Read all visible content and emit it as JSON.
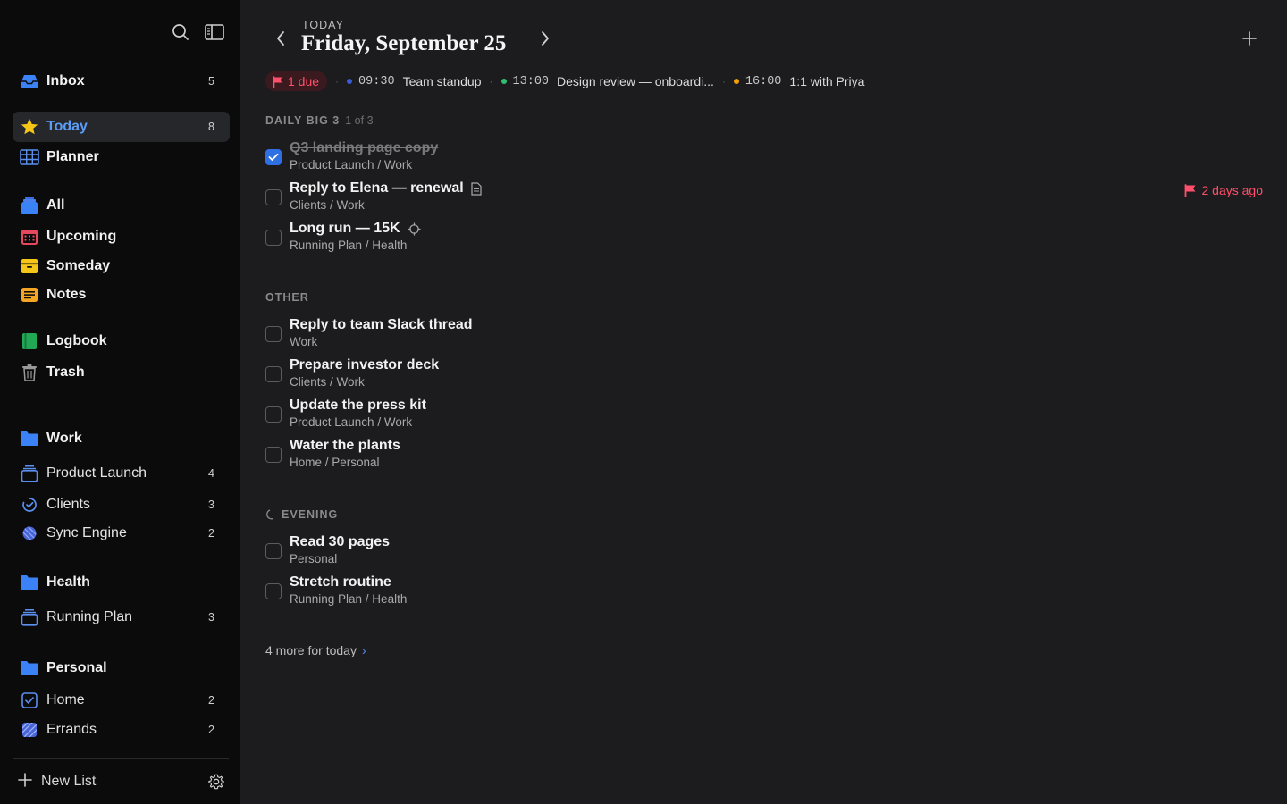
{
  "sidebar": {
    "items": {
      "inbox": {
        "label": "Inbox",
        "count": "5"
      },
      "today": {
        "label": "Today",
        "count": "8"
      },
      "planner": {
        "label": "Planner"
      },
      "all": {
        "label": "All"
      },
      "upcoming": {
        "label": "Upcoming"
      },
      "someday": {
        "label": "Someday"
      },
      "notes": {
        "label": "Notes"
      },
      "logbook": {
        "label": "Logbook"
      },
      "trash": {
        "label": "Trash"
      }
    },
    "areas": {
      "work": {
        "label": "Work"
      },
      "product_launch": {
        "label": "Product Launch",
        "count": "4"
      },
      "clients": {
        "label": "Clients",
        "count": "3"
      },
      "sync_engine": {
        "label": "Sync Engine",
        "count": "2"
      },
      "health": {
        "label": "Health"
      },
      "running_plan": {
        "label": "Running Plan",
        "count": "3"
      },
      "personal": {
        "label": "Personal"
      },
      "home": {
        "label": "Home",
        "count": "2"
      },
      "errands": {
        "label": "Errands",
        "count": "2"
      }
    },
    "new_list_label": "New List"
  },
  "header": {
    "eyebrow": "TODAY",
    "date": "Friday, September 25"
  },
  "agenda": {
    "due_label": "1 due",
    "events": [
      {
        "time": "09:30",
        "title": "Team standup",
        "color": "#3a5bd9"
      },
      {
        "time": "13:00",
        "title": "Design review — onboardi...",
        "color": "#2fbf71"
      },
      {
        "time": "16:00",
        "title": "1:1 with Priya",
        "color": "#f59e0b"
      }
    ]
  },
  "sections": {
    "big3": {
      "title": "DAILY BIG 3",
      "progress": "1 of 3"
    },
    "other": {
      "title": "OTHER"
    },
    "evening": {
      "title": "EVENING"
    }
  },
  "tasks": {
    "big3": [
      {
        "title": "Q3 landing page copy",
        "subtitle": "Product Launch / Work",
        "done": true
      },
      {
        "title": "Reply to Elena — renewal",
        "subtitle": "Clients / Work",
        "deadline": "2 days ago"
      },
      {
        "title": "Long run — 15K",
        "subtitle": "Running Plan / Health"
      }
    ],
    "other": [
      {
        "title": "Reply to team Slack thread",
        "subtitle": "Work"
      },
      {
        "title": "Prepare investor deck",
        "subtitle": "Clients / Work"
      },
      {
        "title": "Update the press kit",
        "subtitle": "Product Launch / Work"
      },
      {
        "title": "Water the plants",
        "subtitle": "Home / Personal"
      }
    ],
    "evening": [
      {
        "title": "Read 30 pages",
        "subtitle": "Personal"
      },
      {
        "title": "Stretch routine",
        "subtitle": "Running Plan / Health"
      }
    ]
  },
  "footer": {
    "more_label": "4 more for today",
    "more_arrow": "›"
  },
  "colors": {
    "accent": "#2f6fe4",
    "today_star": "#f5c518",
    "due_red": "#ff4f6a",
    "folder_blue": "#3b82f6"
  }
}
